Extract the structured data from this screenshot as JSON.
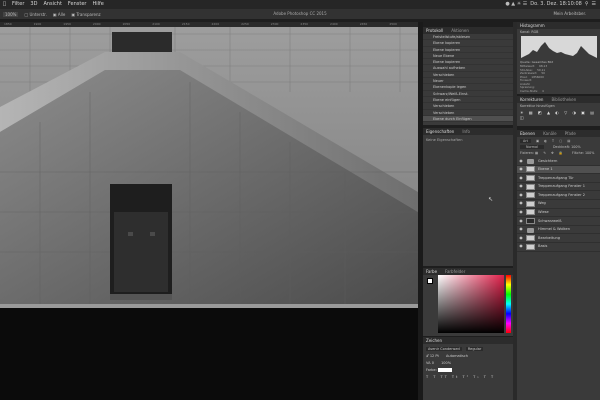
{
  "menubar": {
    "apple": "",
    "items": [
      "Filter",
      "3D",
      "Ansicht",
      "Fenster",
      "Hilfe"
    ],
    "clock": "Do. 3. Dez. 18:10:08",
    "app_title": "Adobe Photoshop CC 2015"
  },
  "optionsbar": {
    "zoom": "100%",
    "check_all_windows": "Unterstr.",
    "check_fill": "Alle",
    "check_transparent": "Transparenz",
    "workspace": "Mein Arbeitsber."
  },
  "history": {
    "tab_active": "Protokoll",
    "tab_other": "Aktionen",
    "items": [
      "Freistellstufe/ablesen",
      "Ebene kopieren",
      "Ebene kopieren",
      "Neue Ebene",
      "Ebene kopieren",
      "Auswahl aufheben",
      "Verschieben",
      "Neuer",
      "Ebenenkopie legen",
      "Schwarz/Weiß-Einst.",
      "Ebene einfügen",
      "Verschieben",
      "Verschieben",
      "Ebene durch Einfügen"
    ],
    "selected_index": 13
  },
  "properties": {
    "tab_active": "Eigenschaften",
    "tab_other": "Info",
    "text": "Keine Eigenschaften"
  },
  "color": {
    "tab_active": "Farbe",
    "tab_other": "Farbfelder",
    "hue_color": "#e0204a"
  },
  "character": {
    "tab_active": "Zeichen",
    "font": "Avenir Condensed",
    "style": "Regular",
    "size": "12 Pt",
    "leading": "Automatisch",
    "tracking": "0",
    "scale": "100%",
    "color_label": "Farbe:"
  },
  "histogram": {
    "tab_active": "Histogramm",
    "channel": "RGB",
    "source": "Gesamtes Bild",
    "stats": [
      {
        "label": "Mittelwert:",
        "value": "68,13"
      },
      {
        "label": "Std-Abw.:",
        "value": "59,11"
      },
      {
        "label": "Zentralwert:",
        "value": "50"
      },
      {
        "label": "Pixel:",
        "value": "1856000"
      },
      {
        "label": "Tonwert:",
        "value": ""
      },
      {
        "label": "Anzahl:",
        "value": ""
      },
      {
        "label": "Spreizung:",
        "value": ""
      },
      {
        "label": "Cache-Stufe:",
        "value": "4"
      }
    ]
  },
  "adjustments": {
    "tab_active": "Korrekturen",
    "tab_other": "Bibliotheken",
    "text": "Korrektur hinzufügen"
  },
  "layers": {
    "tabs": [
      "Ebenen",
      "Kanäle",
      "Pfade"
    ],
    "filter": "Art",
    "blend_mode": "Normal",
    "opacity_label": "Deckkraft:",
    "opacity": "100%",
    "fixieren_label": "Fixieren:",
    "fill_label": "Fläche:",
    "fill": "100%",
    "items": [
      {
        "name": "Gesichtern",
        "type": "folder",
        "visible": true
      },
      {
        "name": "Ebene 1",
        "type": "light",
        "visible": true
      },
      {
        "name": "Treppenaufgang Tür",
        "type": "light",
        "visible": true
      },
      {
        "name": "Treppenaufgang Fenster 1",
        "type": "light",
        "visible": true
      },
      {
        "name": "Treppenaufgang Fenster 2",
        "type": "light",
        "visible": true
      },
      {
        "name": "Weg",
        "type": "light",
        "visible": true
      },
      {
        "name": "Wiese",
        "type": "light",
        "visible": true
      },
      {
        "name": "Schwarzweiß",
        "type": "adjust",
        "visible": true
      },
      {
        "name": "Himmel & Wolken",
        "type": "folder",
        "visible": true
      },
      {
        "name": "Bearbeitung",
        "type": "light",
        "visible": true
      },
      {
        "name": "Basis",
        "type": "light",
        "visible": true
      }
    ],
    "selected_index": 1
  },
  "ruler": [
    "1850",
    "1900",
    "1950",
    "2000",
    "2050",
    "2100",
    "2150",
    "2200",
    "2250",
    "2300",
    "2350",
    "2400",
    "2450",
    "2500",
    "2550",
    "2600"
  ]
}
